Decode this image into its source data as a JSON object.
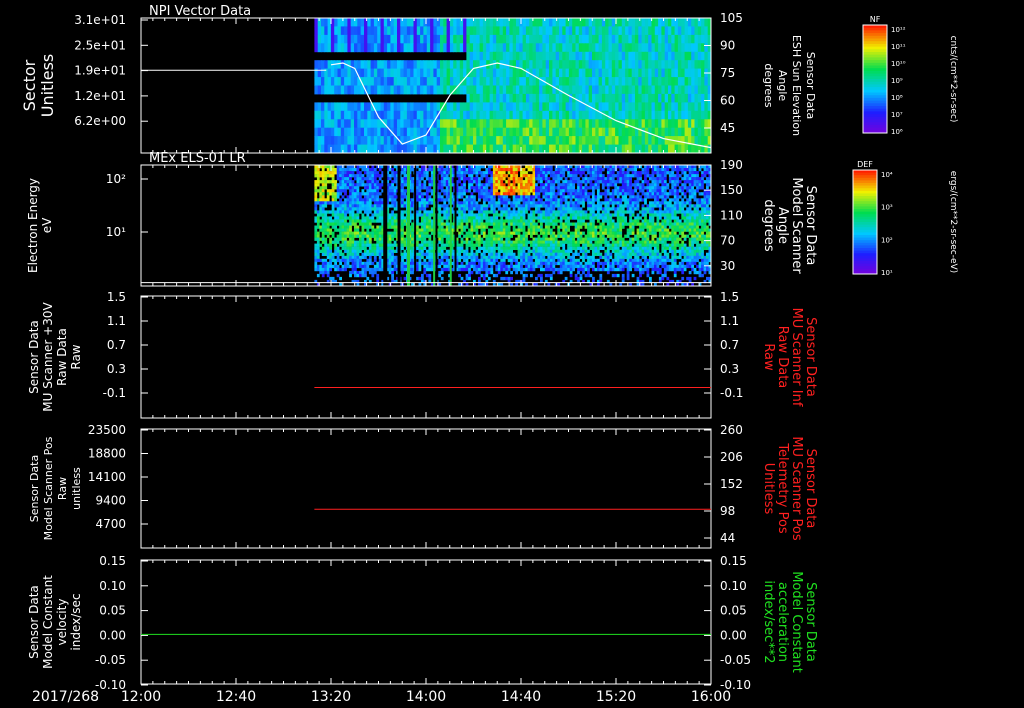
{
  "date_label": "2017/268",
  "time_ticks": [
    "12:00",
    "12:40",
    "13:20",
    "14:00",
    "14:40",
    "15:20",
    "16:00"
  ],
  "colors": {
    "white": "#ffffff",
    "red": "#ff2020",
    "green": "#20e020",
    "black": "#000000"
  },
  "chart_data": [
    {
      "type": "heatmap",
      "title": "NPI Vector Data",
      "ylabel": "Sector\nUnitless",
      "yticks": [
        "3.1e+01",
        "2.5e+01",
        "1.9e+01",
        "1.2e+01",
        "6.2e+00"
      ],
      "right_ylabel": "Sensor Data\nESH Sun Elevation\nAngle\ndegrees",
      "right_yticks": [
        "105",
        "90",
        "75",
        "60",
        "45"
      ],
      "right_ylim": [
        30,
        105
      ],
      "colorbar": {
        "label": "NF",
        "units": "cnts/(cm**2-sr-sec)",
        "ticks": [
          "10¹²",
          "10¹¹",
          "10¹⁰",
          "10⁹",
          "10⁸",
          "10⁷",
          "10⁶"
        ]
      },
      "line_series": {
        "x": [
          "13:20",
          "13:25",
          "13:30",
          "13:40",
          "13:50",
          "14:00",
          "14:10",
          "14:20",
          "14:30",
          "14:40",
          "15:00",
          "15:20",
          "15:40",
          "16:00"
        ],
        "y": [
          79,
          80,
          77,
          50,
          35,
          40,
          62,
          77,
          80,
          77,
          62,
          48,
          38,
          33
        ]
      },
      "reference_line": {
        "y": 76
      }
    },
    {
      "type": "heatmap",
      "title": "MEx ELS-01 LR",
      "ylabel": "Electron Energy\neV",
      "yticks": [
        "10²",
        "10¹"
      ],
      "right_ylabel": "Sensor Data\nModel Scanner\nAngle\ndegrees",
      "right_yticks": [
        "190",
        "150",
        "110",
        "70",
        "30"
      ],
      "right_ylim": [
        10,
        190
      ],
      "colorbar": {
        "label": "DEF",
        "units": "ergs/(cm**2-sr-sec-eV)",
        "ticks": [
          "10⁴",
          "10³",
          "10²",
          "10¹"
        ]
      },
      "reference_line": {
        "y": 15
      }
    },
    {
      "type": "line",
      "ylabel": "Sensor Data\nMU Scanner +30V\nRaw Data\nRaw",
      "yticks": [
        "1.5",
        "1.1",
        "0.7",
        "0.3",
        "-0.1"
      ],
      "ylim": [
        -0.5,
        1.5
      ],
      "right_ylabel": "Sensor Data\nMU Scanner Inf\nRaw Data\nRaw",
      "right_yticks": [
        "1.5",
        "1.1",
        "0.7",
        "0.3",
        "-0.1"
      ],
      "series": [
        {
          "x": [
            "13:13",
            "16:00"
          ],
          "y": [
            0.0,
            0.0
          ]
        }
      ]
    },
    {
      "type": "line",
      "ylabel": "Sensor Data\nModel Scanner Pos\nRaw\nunitless",
      "yticks": [
        "23500",
        "18800",
        "14100",
        "9400",
        "4700"
      ],
      "ylim": [
        0,
        23500
      ],
      "right_ylabel": "Sensor Data\nMU Scanner Pos\nTelemetry Pos\nUnitless",
      "right_yticks": [
        "260",
        "206",
        "152",
        "98",
        "44"
      ],
      "series": [
        {
          "x": [
            "13:13",
            "16:00"
          ],
          "y": [
            7650,
            7650
          ]
        }
      ]
    },
    {
      "type": "line",
      "ylabel": "Sensor Data\nModel Constant\nvelocity\nindex/sec",
      "yticks": [
        "0.15",
        "0.10",
        "0.05",
        "0.00",
        "-0.05",
        "-0.10"
      ],
      "ylim": [
        -0.1,
        0.15
      ],
      "right_ylabel": "Sensor Data\nModel Constant\nacceleration\nindex/sec**2",
      "right_yticks": [
        "0.15",
        "0.10",
        "0.05",
        "0.00",
        "-0.05",
        "-0.10"
      ],
      "series": [
        {
          "x": [
            "12:00",
            "16:00"
          ],
          "y": [
            0.0,
            0.0
          ]
        }
      ]
    }
  ]
}
